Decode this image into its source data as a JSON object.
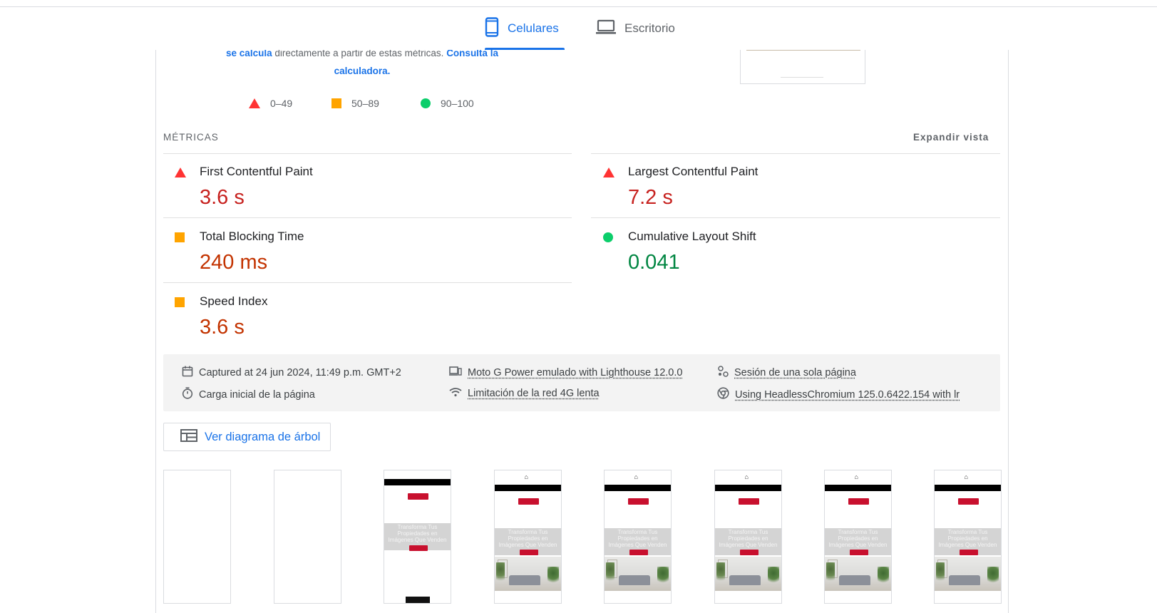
{
  "tabs": {
    "mobile_label": "Celulares",
    "desktop_label": "Escritorio"
  },
  "calc": {
    "link1": "se calcula",
    "text": " directamente a partir de estas métricas. ",
    "link2": "Consulta la calculadora."
  },
  "legend": [
    {
      "range": "0–49",
      "icon": "fail-triangle-icon"
    },
    {
      "range": "50–89",
      "icon": "average-square-icon"
    },
    {
      "range": "90–100",
      "icon": "pass-circle-icon"
    }
  ],
  "metrics": {
    "section_label": "MÉTRICAS",
    "expand_label": "Expandir vista",
    "items": [
      {
        "name": "First Contentful Paint",
        "value": "3.6 s",
        "rating": "fail"
      },
      {
        "name": "Largest Contentful Paint",
        "value": "7.2 s",
        "rating": "fail"
      },
      {
        "name": "Total Blocking Time",
        "value": "240 ms",
        "rating": "average"
      },
      {
        "name": "Cumulative Layout Shift",
        "value": "0.041",
        "rating": "pass"
      },
      {
        "name": "Speed Index",
        "value": "3.6 s",
        "rating": "average"
      }
    ]
  },
  "runtime": {
    "captured": "Captured at 24 jun 2024, 11:49 p.m. GMT+2",
    "device": "Moto G Power emulado with Lighthouse 12.0.0",
    "session": "Sesión de una sola página",
    "load": "Carga inicial de la página",
    "network": "Limitación de la red 4G lenta",
    "browser": "Using HeadlessChromium 125.0.6422.154 with lr"
  },
  "treemap_button": "Ver diagrama de árbol",
  "filmstrip": {
    "hero_text": "Transforma Tus Propiedades en Imágenes Que Venden"
  },
  "colors": {
    "accent": "#1a73e8",
    "fail": "#ff3333",
    "average": "#ffa400",
    "pass": "#0cce6b",
    "fail_text": "#c7221f",
    "average_text": "#c33300",
    "pass_text": "#018642"
  }
}
